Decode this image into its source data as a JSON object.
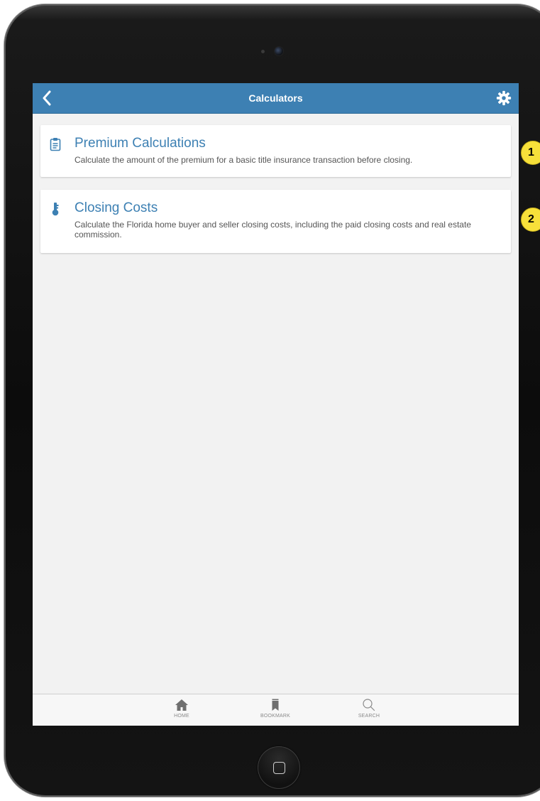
{
  "header": {
    "title": "Calculators"
  },
  "cards": [
    {
      "title": "Premium Calculations",
      "description": "Calculate the amount of the premium for a basic title insurance transaction before closing.",
      "icon": "clipboard-icon"
    },
    {
      "title": "Closing Costs",
      "description": "Calculate the Florida home buyer and seller closing costs, including the paid closing costs and real estate commission.",
      "icon": "key-icon"
    }
  ],
  "tabbar": {
    "home_label": "HOME",
    "bookmark_label": "BOOKMARK",
    "search_label": "SEARCH"
  },
  "annotations": {
    "badge_1": "1",
    "badge_2": "2"
  },
  "colors": {
    "accent": "#3d80b3",
    "background": "#f2f2f2",
    "badge": "#f7e03a"
  }
}
